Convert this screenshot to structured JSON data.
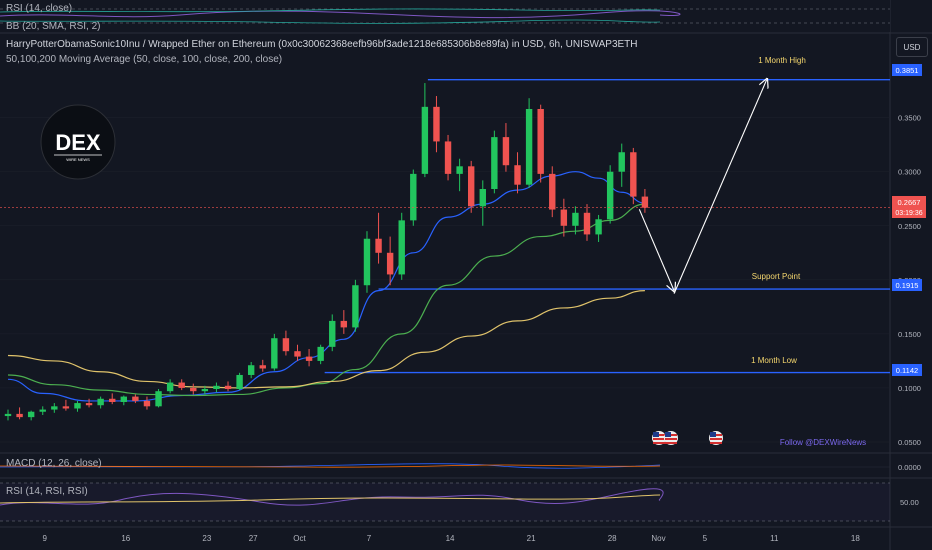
{
  "header": {
    "title": "HarryPotterObamaSonic10Inu / Wrapped Ether on Ethereum (0x0c30062368eefb96bf3ade1218e685306b8e89fa) in USD, 6h, UNISWAP3ETH",
    "indicator": "50,100,200 Moving Average (50, close, 100, close, 200, close)",
    "currency": "USD"
  },
  "top_pane": {
    "line1": "RSI (14, close)",
    "line2": "BB (20, SMA, RSI, 2)"
  },
  "macd_pane": {
    "label": "MACD (12, 26, close)",
    "axis_label": "0.0000"
  },
  "rsi_pane": {
    "label": "RSI (14, RSI, RSI)",
    "axis_label": "50.00"
  },
  "logo": {
    "text": "DEX",
    "subtext": "WIRE NEWS"
  },
  "watermark": "Follow @DEXWireNews",
  "annotations": {
    "month_high": "1 Month High",
    "support": "Support Point",
    "month_low": "1 Month Low"
  },
  "price_tags": {
    "high": "0.3851",
    "current": "0.2667",
    "countdown": "03:19:36",
    "support": "0.1915",
    "low": "0.1142"
  },
  "colors": {
    "background": "#131722",
    "up": "#26a69a",
    "up_bright": "#22c55e",
    "down": "#ef5350",
    "ma50": "#2962ff",
    "ma100": "#4caf50",
    "ma200": "#e0c36b",
    "level_line": "#2962ff",
    "annotation_text": "#f5d76e",
    "watermark": "#7b68ee"
  },
  "chart_data": {
    "type": "candlestick",
    "y_axis_ticks": [
      "0.3500",
      "0.3000",
      "0.2500",
      "0.2000",
      "0.1500",
      "0.1000",
      "0.0500"
    ],
    "x_axis_ticks": [
      "9",
      "16",
      "23",
      "27",
      "Oct",
      "7",
      "14",
      "21",
      "28",
      "Nov",
      "5",
      "11",
      "18"
    ],
    "ylim": [
      0.05,
      0.395
    ],
    "levels": [
      {
        "name": "1 Month High",
        "value": 0.3851
      },
      {
        "name": "Support Point",
        "value": 0.1915
      },
      {
        "name": "1 Month Low",
        "value": 0.1142
      }
    ],
    "current_price": 0.2667,
    "projection_arrows": [
      {
        "from": [
          "Oct 30",
          0.268
        ],
        "to": [
          "Nov 2",
          0.19
        ]
      },
      {
        "from": [
          "Nov 2",
          0.19
        ],
        "to": [
          "Nov 10",
          0.3851
        ]
      }
    ],
    "ma_series": [
      {
        "name": "MA50",
        "points": [
          [
            "Sep 6",
            0.108
          ],
          [
            "Sep 9",
            0.095
          ],
          [
            "Sep 13",
            0.088
          ],
          [
            "Sep 17",
            0.088
          ],
          [
            "Sep 21",
            0.093
          ],
          [
            "Sep 25",
            0.096
          ],
          [
            "Sep 29",
            0.115
          ],
          [
            "Oct 2",
            0.128
          ],
          [
            "Oct 5",
            0.145
          ],
          [
            "Oct 8",
            0.19
          ],
          [
            "Oct 11",
            0.225
          ],
          [
            "Oct 14",
            0.258
          ],
          [
            "Oct 17",
            0.27
          ],
          [
            "Oct 20",
            0.283
          ],
          [
            "Oct 23",
            0.296
          ],
          [
            "Oct 25",
            0.3
          ],
          [
            "Oct 27",
            0.294
          ],
          [
            "Oct 29",
            0.281
          ],
          [
            "Oct 31",
            0.271
          ]
        ]
      },
      {
        "name": "MA100",
        "points": [
          [
            "Sep 6",
            0.112
          ],
          [
            "Sep 10",
            0.103
          ],
          [
            "Sep 14",
            0.098
          ],
          [
            "Sep 18",
            0.094
          ],
          [
            "Sep 22",
            0.093
          ],
          [
            "Sep 26",
            0.094
          ],
          [
            "Sep 30",
            0.1
          ],
          [
            "Oct 3",
            0.104
          ],
          [
            "Oct 6",
            0.117
          ],
          [
            "Oct 10",
            0.15
          ],
          [
            "Oct 14",
            0.195
          ],
          [
            "Oct 18",
            0.222
          ],
          [
            "Oct 22",
            0.24
          ],
          [
            "Oct 25",
            0.245
          ],
          [
            "Oct 28",
            0.255
          ],
          [
            "Oct 31",
            0.27
          ]
        ]
      },
      {
        "name": "MA200",
        "points": [
          [
            "Sep 6",
            0.13
          ],
          [
            "Sep 10",
            0.125
          ],
          [
            "Sep 14",
            0.115
          ],
          [
            "Sep 18",
            0.106
          ],
          [
            "Sep 22",
            0.101
          ],
          [
            "Sep 26",
            0.1
          ],
          [
            "Sep 30",
            0.101
          ],
          [
            "Oct 4",
            0.106
          ],
          [
            "Oct 8",
            0.116
          ],
          [
            "Oct 12",
            0.133
          ],
          [
            "Oct 16",
            0.148
          ],
          [
            "Oct 20",
            0.162
          ],
          [
            "Oct 24",
            0.174
          ],
          [
            "Oct 28",
            0.183
          ],
          [
            "Oct 31",
            0.19
          ]
        ]
      }
    ],
    "candles": [
      {
        "date": "Sep 6",
        "o": 0.074,
        "h": 0.08,
        "l": 0.07,
        "c": 0.076
      },
      {
        "date": "Sep 7",
        "o": 0.076,
        "h": 0.082,
        "l": 0.071,
        "c": 0.073
      },
      {
        "date": "Sep 8",
        "o": 0.073,
        "h": 0.079,
        "l": 0.07,
        "c": 0.078
      },
      {
        "date": "Sep 9",
        "o": 0.078,
        "h": 0.083,
        "l": 0.075,
        "c": 0.08
      },
      {
        "date": "Sep 10",
        "o": 0.08,
        "h": 0.086,
        "l": 0.077,
        "c": 0.083
      },
      {
        "date": "Sep 11",
        "o": 0.083,
        "h": 0.089,
        "l": 0.079,
        "c": 0.081
      },
      {
        "date": "Sep 12",
        "o": 0.081,
        "h": 0.088,
        "l": 0.078,
        "c": 0.086
      },
      {
        "date": "Sep 13",
        "o": 0.086,
        "h": 0.09,
        "l": 0.082,
        "c": 0.084
      },
      {
        "date": "Sep 14",
        "o": 0.084,
        "h": 0.092,
        "l": 0.081,
        "c": 0.09
      },
      {
        "date": "Sep 15",
        "o": 0.09,
        "h": 0.095,
        "l": 0.085,
        "c": 0.087
      },
      {
        "date": "Sep 16",
        "o": 0.087,
        "h": 0.093,
        "l": 0.084,
        "c": 0.092
      },
      {
        "date": "Sep 17",
        "o": 0.092,
        "h": 0.094,
        "l": 0.086,
        "c": 0.088
      },
      {
        "date": "Sep 18",
        "o": 0.088,
        "h": 0.092,
        "l": 0.08,
        "c": 0.083
      },
      {
        "date": "Sep 19",
        "o": 0.083,
        "h": 0.099,
        "l": 0.082,
        "c": 0.097
      },
      {
        "date": "Sep 20",
        "o": 0.097,
        "h": 0.108,
        "l": 0.095,
        "c": 0.105
      },
      {
        "date": "Sep 21",
        "o": 0.105,
        "h": 0.108,
        "l": 0.098,
        "c": 0.1
      },
      {
        "date": "Sep 22",
        "o": 0.1,
        "h": 0.104,
        "l": 0.094,
        "c": 0.097
      },
      {
        "date": "Sep 23",
        "o": 0.097,
        "h": 0.102,
        "l": 0.094,
        "c": 0.099
      },
      {
        "date": "Sep 24",
        "o": 0.099,
        "h": 0.105,
        "l": 0.096,
        "c": 0.102
      },
      {
        "date": "Sep 25",
        "o": 0.102,
        "h": 0.106,
        "l": 0.097,
        "c": 0.099
      },
      {
        "date": "Sep 26",
        "o": 0.099,
        "h": 0.114,
        "l": 0.098,
        "c": 0.112
      },
      {
        "date": "Sep 27",
        "o": 0.112,
        "h": 0.124,
        "l": 0.109,
        "c": 0.121
      },
      {
        "date": "Sep 28",
        "o": 0.121,
        "h": 0.126,
        "l": 0.115,
        "c": 0.118
      },
      {
        "date": "Sep 29",
        "o": 0.118,
        "h": 0.15,
        "l": 0.116,
        "c": 0.146
      },
      {
        "date": "Sep 30",
        "o": 0.146,
        "h": 0.153,
        "l": 0.13,
        "c": 0.134
      },
      {
        "date": "Oct 1",
        "o": 0.134,
        "h": 0.14,
        "l": 0.125,
        "c": 0.129
      },
      {
        "date": "Oct 2",
        "o": 0.129,
        "h": 0.136,
        "l": 0.12,
        "c": 0.125
      },
      {
        "date": "Oct 3",
        "o": 0.125,
        "h": 0.14,
        "l": 0.122,
        "c": 0.138
      },
      {
        "date": "Oct 4",
        "o": 0.138,
        "h": 0.168,
        "l": 0.134,
        "c": 0.162
      },
      {
        "date": "Oct 5",
        "o": 0.162,
        "h": 0.172,
        "l": 0.15,
        "c": 0.156
      },
      {
        "date": "Oct 6",
        "o": 0.156,
        "h": 0.2,
        "l": 0.152,
        "c": 0.195
      },
      {
        "date": "Oct 7",
        "o": 0.195,
        "h": 0.245,
        "l": 0.188,
        "c": 0.238
      },
      {
        "date": "Oct 8",
        "o": 0.238,
        "h": 0.262,
        "l": 0.215,
        "c": 0.225
      },
      {
        "date": "Oct 9",
        "o": 0.225,
        "h": 0.24,
        "l": 0.195,
        "c": 0.205
      },
      {
        "date": "Oct 10",
        "o": 0.205,
        "h": 0.262,
        "l": 0.2,
        "c": 0.255
      },
      {
        "date": "Oct 11",
        "o": 0.255,
        "h": 0.302,
        "l": 0.25,
        "c": 0.298
      },
      {
        "date": "Oct 12",
        "o": 0.298,
        "h": 0.382,
        "l": 0.295,
        "c": 0.36
      },
      {
        "date": "Oct 13",
        "o": 0.36,
        "h": 0.37,
        "l": 0.318,
        "c": 0.328
      },
      {
        "date": "Oct 14",
        "o": 0.328,
        "h": 0.334,
        "l": 0.292,
        "c": 0.298
      },
      {
        "date": "Oct 15",
        "o": 0.298,
        "h": 0.312,
        "l": 0.282,
        "c": 0.305
      },
      {
        "date": "Oct 16",
        "o": 0.305,
        "h": 0.31,
        "l": 0.262,
        "c": 0.268
      },
      {
        "date": "Oct 17",
        "o": 0.268,
        "h": 0.292,
        "l": 0.25,
        "c": 0.284
      },
      {
        "date": "Oct 18",
        "o": 0.284,
        "h": 0.338,
        "l": 0.28,
        "c": 0.332
      },
      {
        "date": "Oct 19",
        "o": 0.332,
        "h": 0.345,
        "l": 0.3,
        "c": 0.306
      },
      {
        "date": "Oct 20",
        "o": 0.306,
        "h": 0.318,
        "l": 0.28,
        "c": 0.288
      },
      {
        "date": "Oct 21",
        "o": 0.288,
        "h": 0.368,
        "l": 0.285,
        "c": 0.358
      },
      {
        "date": "Oct 22",
        "o": 0.358,
        "h": 0.362,
        "l": 0.29,
        "c": 0.298
      },
      {
        "date": "Oct 23",
        "o": 0.298,
        "h": 0.305,
        "l": 0.258,
        "c": 0.265
      },
      {
        "date": "Oct 24",
        "o": 0.265,
        "h": 0.275,
        "l": 0.24,
        "c": 0.25
      },
      {
        "date": "Oct 25",
        "o": 0.25,
        "h": 0.268,
        "l": 0.242,
        "c": 0.262
      },
      {
        "date": "Oct 26",
        "o": 0.262,
        "h": 0.27,
        "l": 0.236,
        "c": 0.242
      },
      {
        "date": "Oct 27",
        "o": 0.242,
        "h": 0.26,
        "l": 0.235,
        "c": 0.256
      },
      {
        "date": "Oct 28",
        "o": 0.256,
        "h": 0.306,
        "l": 0.252,
        "c": 0.3
      },
      {
        "date": "Oct 29",
        "o": 0.3,
        "h": 0.326,
        "l": 0.286,
        "c": 0.318
      },
      {
        "date": "Oct 30",
        "o": 0.318,
        "h": 0.322,
        "l": 0.27,
        "c": 0.277
      },
      {
        "date": "Oct 31",
        "o": 0.277,
        "h": 0.284,
        "l": 0.262,
        "c": 0.2667
      }
    ]
  }
}
